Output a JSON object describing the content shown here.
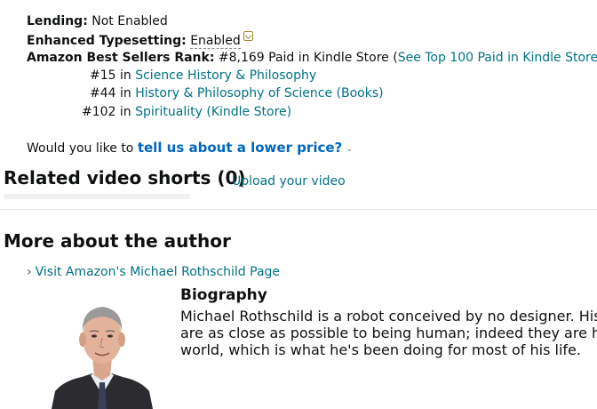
{
  "product_details": {
    "lending": {
      "label": "Lending:",
      "value": "Not Enabled"
    },
    "typesetting": {
      "label": "Enhanced Typesetting:",
      "value": "Enabled"
    },
    "best_sellers": {
      "label": "Amazon Best Sellers Rank:",
      "value": "#8,169 Paid in Kindle Store (",
      "top100_link": "See Top 100 Paid in Kindle Store",
      "close_paren": ")",
      "sub_ranks": [
        {
          "rank": "#15 in ",
          "category": "Science History & Philosophy"
        },
        {
          "rank": "#44 in ",
          "category": "History & Philosophy of Science (Books)"
        },
        {
          "rank": "#102 in ",
          "category": "Spirituality (Kindle Store)"
        }
      ]
    }
  },
  "lower_price": {
    "prefix": "Would you like to ",
    "link": "tell us about a lower price?"
  },
  "video_shorts": {
    "heading": "Related video shorts (0)",
    "upload_link": "Upload your video"
  },
  "author_section": {
    "heading": "More about the author",
    "visit_link": "Visit Amazon's Michael Rothschild Page",
    "bio_title": "Biography",
    "bio_lines": [
      "Michael Rothschild is a robot conceived by no designer. His creators were robots",
      "are as close as possible to being human; indeed they are human. Although the",
      "world, which is what he's been doing for most of his life."
    ]
  },
  "colors": {
    "link": "#007185",
    "price_link": "#0066c0",
    "text": "#0f1111"
  },
  "icons": {
    "typesetting_info": "chevron-down-box-icon",
    "price_caret": "chevron-down-icon",
    "visit_chevron": "chevron-right-icon"
  }
}
